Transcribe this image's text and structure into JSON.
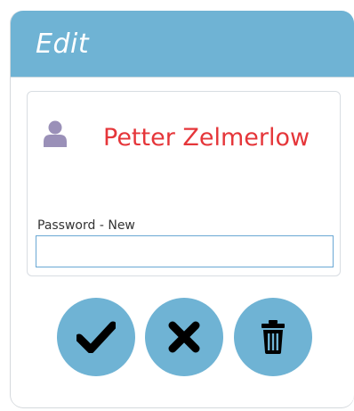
{
  "dialog": {
    "title": "Edit"
  },
  "user": {
    "name": "Petter Zelmerlow",
    "icon": "user-icon"
  },
  "password": {
    "label": "Password - New",
    "value": ""
  },
  "actions": {
    "confirm_icon": "check-icon",
    "cancel_icon": "close-icon",
    "delete_icon": "trash-icon"
  },
  "colors": {
    "header": "#6fb3d4",
    "button": "#6fb3d4",
    "user_name": "#e5363a",
    "user_icon": "#9a90b8"
  }
}
